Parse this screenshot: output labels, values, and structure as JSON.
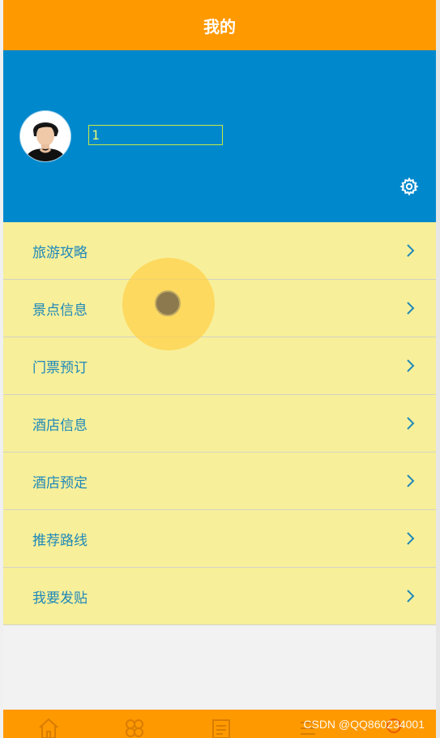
{
  "header": {
    "title": "我的"
  },
  "profile": {
    "username_value": "1"
  },
  "menu": {
    "items": [
      {
        "label": "旅游攻略"
      },
      {
        "label": "景点信息"
      },
      {
        "label": "门票预订"
      },
      {
        "label": "酒店信息"
      },
      {
        "label": "酒店预定"
      },
      {
        "label": "推荐路线"
      },
      {
        "label": "我要发贴"
      }
    ]
  },
  "tabbar": {
    "icons": [
      "home-icon",
      "category-icon",
      "notes-icon",
      "list-icon",
      "user-icon"
    ]
  },
  "watermark": "CSDN @QQ860234001",
  "colors": {
    "header": "#ff9900",
    "profile_bg": "#0088cc",
    "menu_bg": "#f7ef9a",
    "menu_text": "#1f88b9",
    "tabbar": "#ff9900"
  }
}
